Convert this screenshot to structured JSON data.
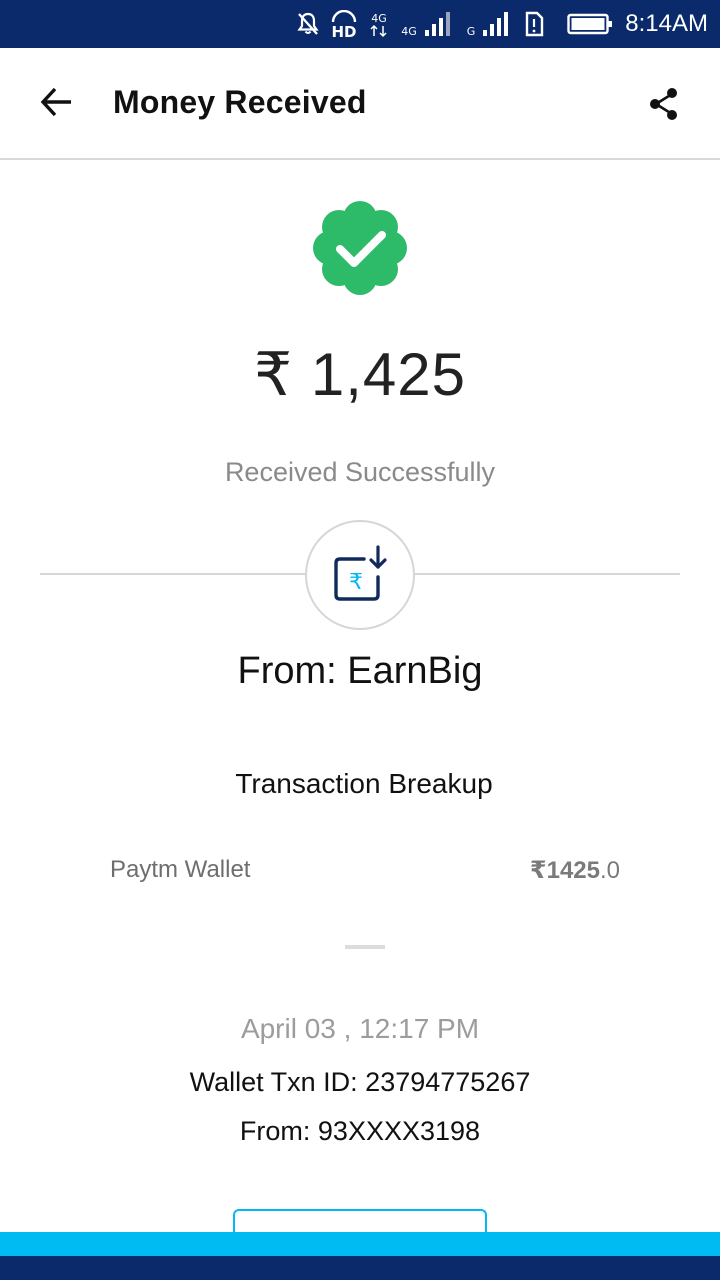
{
  "status_bar": {
    "time": "8:14AM",
    "network_labels": [
      "HD",
      "4G",
      "4G",
      "G"
    ],
    "icons": [
      "bell-off-icon",
      "hd-icon",
      "data-icon",
      "signal-icon",
      "signal-icon",
      "sim-icon",
      "battery-icon"
    ]
  },
  "header": {
    "title": "Money Received",
    "back_icon": "arrow-left-icon",
    "share_icon": "share-icon"
  },
  "transaction": {
    "status_icon": "verified-check-icon",
    "amount": "₹ 1,425",
    "status_text": "Received Successfully",
    "receive_icon": "rupee-receive-icon",
    "from_label": "From: EarnBig",
    "breakup_title": "Transaction Breakup",
    "breakup": [
      {
        "label": "Paytm Wallet",
        "amount_main": "₹1425",
        "amount_decimal": ".0"
      }
    ],
    "date": "April 03 , 12:17 PM",
    "wallet_txn_id": "Wallet Txn ID: 23794775267",
    "from_number": "From: 93XXXX3198"
  },
  "colors": {
    "status_bar": "#0a2a6b",
    "success_green": "#2dbb6a",
    "accent_blue": "#00baf2",
    "icon_navy": "#102a5c"
  }
}
